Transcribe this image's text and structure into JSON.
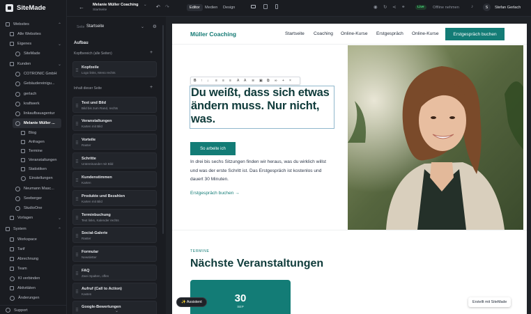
{
  "app": {
    "name": "SiteMade"
  },
  "nav": {
    "section_websites": "Websites",
    "all_websites": "Alle Websites",
    "group_own": "Eigenes",
    "own_items": [
      "SiteMade"
    ],
    "group_clients": "Kunden",
    "client_items": [
      "COTRONIC GmbH",
      "Gebäudereinigu...",
      "gerlach",
      "kraftwerk",
      "linkaufbauagentur",
      "Melanie Müller ..."
    ],
    "site_subitems": [
      "Blog",
      "Anfragen",
      "Termine",
      "Veranstaltungen",
      "Statistiken",
      "Einstellungen"
    ],
    "client_items_after": [
      "Neumann Masc...",
      "Seeberger",
      "StudioOne"
    ],
    "group_templates": "Vorlagen",
    "section_system": "System",
    "system_items": [
      "Workspace",
      "Tarif",
      "Abrechnung",
      "Team",
      "KI verbinden",
      "Aktivitäten",
      "Änderungen"
    ],
    "support": "Support"
  },
  "topbar": {
    "back_icon": "arrow-left-icon",
    "site_title": "Melanie Müller Coaching",
    "site_subtitle": "Startseite",
    "modes": [
      "Editor",
      "Medien",
      "Design"
    ],
    "active_mode": "Editor",
    "live_badge": "Live",
    "offline_label": "Offline nehmen",
    "user_initial": "S",
    "user_name": "Stefan Gerlach"
  },
  "panel": {
    "page_label": "Seite",
    "page_value": "Startseite",
    "structure_title": "Aufbau",
    "header_section": "Kopfbereich (alle Seiten)",
    "header_card": {
      "title": "Kopfzeile",
      "subtitle": "Logo links, Menü rechts"
    },
    "content_section": "Inhalt dieser Seite",
    "blocks": [
      {
        "title": "Text und Bild",
        "subtitle": "Bild bis zum Rand, rechts"
      },
      {
        "title": "Veranstaltungen",
        "subtitle": "Karten mit Bild"
      },
      {
        "title": "Vorteile",
        "subtitle": "Raster"
      },
      {
        "title": "Schritte",
        "subtitle": "Untereinander mit Bild"
      },
      {
        "title": "Kundenstimmen",
        "subtitle": "Karten"
      },
      {
        "title": "Produkte und Bezahlen",
        "subtitle": "Karten mit Bild"
      },
      {
        "title": "Terminbuchung",
        "subtitle": "Text links, Kalender rechts"
      },
      {
        "title": "Social-Galerie",
        "subtitle": "Raster"
      },
      {
        "title": "Formular",
        "subtitle": "Newsletter"
      },
      {
        "title": "FAQ",
        "subtitle": "Zwei Spalten, offen"
      },
      {
        "title": "Aufruf (Call to Action)",
        "subtitle": "Kasten"
      },
      {
        "title": "Google-Bewertungen",
        "subtitle": ""
      }
    ]
  },
  "site": {
    "logo": "Müller Coaching",
    "menu": [
      "Startseite",
      "Coaching",
      "Online-Kurse",
      "Erstgespräch",
      "Online-Kurse"
    ],
    "cta": "Erstgespräch buchen",
    "hero_title": "Du weißt, dass sich etwas ändern muss. Nur nicht, was.",
    "hero_button": "So arbeite ich",
    "hero_text": "In drei bis sechs Sitzungen finden wir heraus, was du wirklich willst und was der erste Schritt ist. Das Erstgespräch ist kostenlos und dauert 30 Minuten.",
    "hero_link": "Erstgespräch buchen →",
    "termine_label": "TERMINE",
    "events_heading": "Nächste Veranstaltungen",
    "event_day": "30",
    "event_month": "SEP"
  },
  "floating": {
    "assistant": "✨ Assistent",
    "made_with": "Erstellt mit SiteMade"
  },
  "colors": {
    "accent": "#137c76",
    "dark": "#1a1c21",
    "heading": "#0f3b3a",
    "live": "#22c55e"
  }
}
